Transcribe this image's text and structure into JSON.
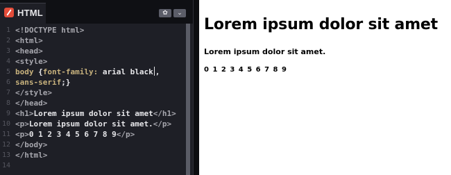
{
  "editor": {
    "tab_label": "HTML",
    "tab_icon": "html-file-icon",
    "settings_icon": "gear-icon",
    "settings_glyph": "✿",
    "collapse_icon": "chevron-down-icon",
    "collapse_glyph": "⌄",
    "line_numbers": [
      "1",
      "2",
      "3",
      "4",
      "5",
      "6",
      "7",
      "8",
      "9",
      "10",
      "11",
      "12",
      "13",
      "14"
    ],
    "code": {
      "l1": "<!DOCTYPE html>",
      "l2": "<html>",
      "l3": "<head>",
      "l4": "<style>",
      "l5_sel": "body ",
      "l5_open": "{",
      "l5_prop": "font-family:",
      "l5_val": " arial black",
      "l5_comma": ",",
      "l6_val": "sans-serif",
      "l6_end": ";}",
      "l7": "</style>",
      "l8": "</head>",
      "l9_open": "<h1>",
      "l9_text": "Lorem ipsum dolor sit amet",
      "l9_close": "</h1>",
      "l10_open": "<p>",
      "l10_text": "Lorem ipsum dolor sit amet.",
      "l10_close": "</p>",
      "l11_open": "<p>",
      "l11_text": "0 1 2 3 4 5 6 7 8 9",
      "l11_close": "</p>",
      "l12": "</body>",
      "l13": "</html>"
    }
  },
  "preview": {
    "heading": "Lorem ipsum dolor sit amet",
    "paragraph": "Lorem ipsum dolor sit amet.",
    "digits": "0 1 2 3 4 5 6 7 8 9"
  },
  "colors": {
    "editor_bg": "#1e1f26",
    "tab_icon": "#e44d3a",
    "tag_text": "#a7a7ae",
    "property_text": "#c8b27d",
    "preview_bg": "#ffffff"
  }
}
